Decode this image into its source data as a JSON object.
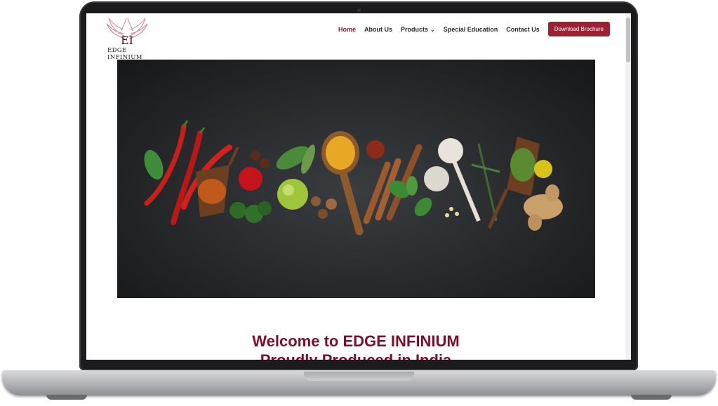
{
  "brand": {
    "logo_text": "EDGE INFINIUM",
    "logo_monogram": "EI",
    "accent": "#9c2233",
    "headline_color": "#7d0f2a"
  },
  "nav": {
    "items": [
      {
        "label": "Home",
        "active": true
      },
      {
        "label": "About Us"
      },
      {
        "label": "Products",
        "has_dropdown": true
      },
      {
        "label": "Special Education"
      },
      {
        "label": "Contact Us"
      }
    ],
    "cta": "Download Brochure"
  },
  "hero": {
    "alt": "spices"
  },
  "content": {
    "heading": "Welcome to EDGE INFINIUM",
    "subheading": "Proudly Produced in India"
  }
}
